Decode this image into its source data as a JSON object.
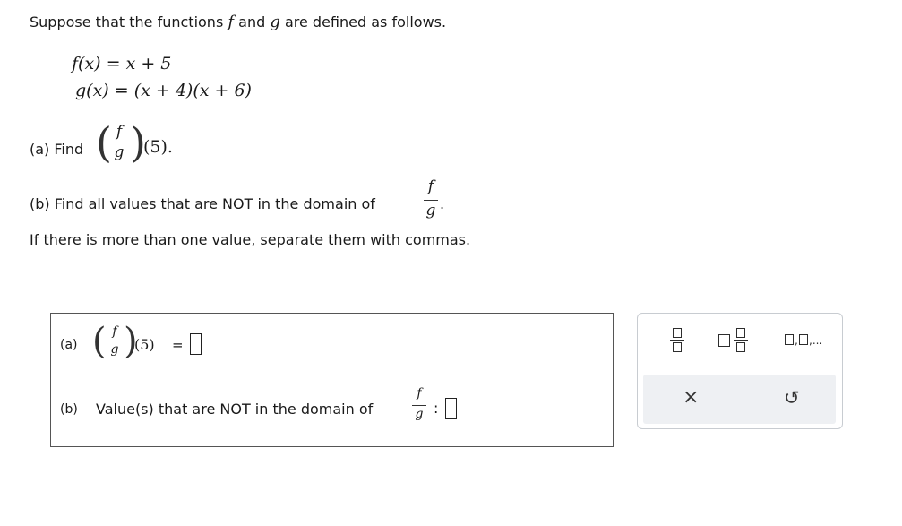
{
  "intro": {
    "before": "Suppose that the functions",
    "f": "f",
    "and": "and",
    "g": "g",
    "after": "are defined as follows."
  },
  "definitions": {
    "f_def": "f(x) = x + 5",
    "g_def": "g(x) = (x + 4)(x + 6)"
  },
  "part_a": {
    "prompt": "(a) Find",
    "arg": "(5).",
    "num": "f",
    "den": "g"
  },
  "part_b": {
    "prompt": "(b) Find all values that are NOT in the domain of",
    "num": "f",
    "den": "g",
    "period": ".",
    "instruction": "If there is more than one value, separate them with commas."
  },
  "answer": {
    "a_label": "(a)",
    "a_num": "f",
    "a_den": "g",
    "a_arg": "(5)",
    "a_eq": "=",
    "a_value": "",
    "b_label": "(b)",
    "b_text": "Value(s) that are NOT in the domain of",
    "b_num": "f",
    "b_den": "g",
    "b_colon": ":",
    "b_value": ""
  },
  "toolbar": {
    "tools": [
      "fraction-tool",
      "mixed-number-tool",
      "list-tool"
    ],
    "list_tool_label": "□,□,...",
    "clear_label": "×",
    "undo_label": "↺"
  },
  "colors": {
    "border": "#555555",
    "toolbar_bg": "#eef0f3",
    "toolbar_border": "#c8ccd1"
  }
}
